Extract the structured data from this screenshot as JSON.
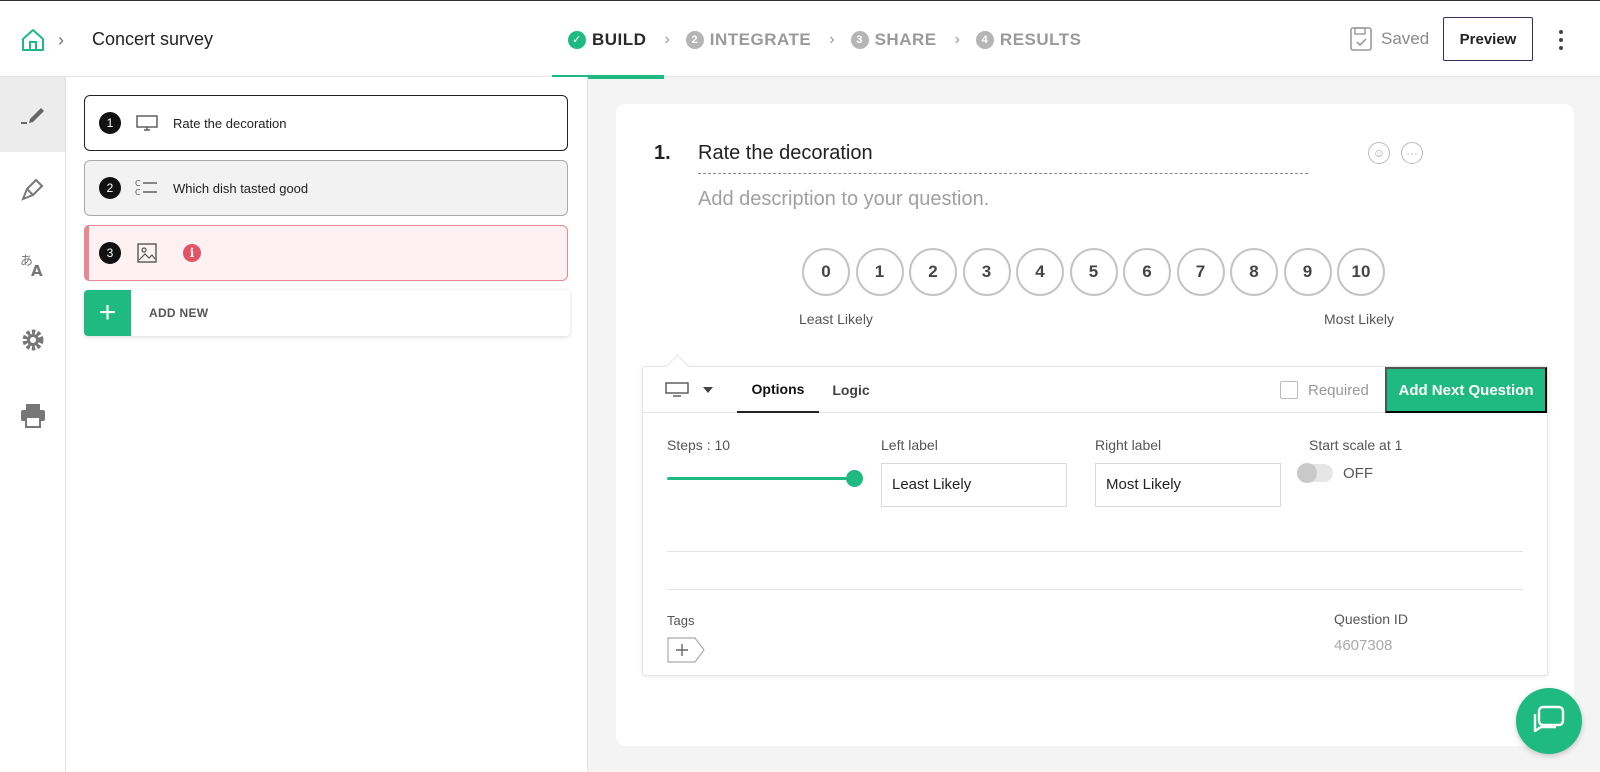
{
  "header": {
    "survey_title": "Concert survey",
    "steps": [
      {
        "num": "✓",
        "label": "BUILD"
      },
      {
        "num": "2",
        "label": "INTEGRATE"
      },
      {
        "num": "3",
        "label": "SHARE"
      },
      {
        "num": "4",
        "label": "RESULTS"
      }
    ],
    "saved_label": "Saved",
    "preview_label": "Preview"
  },
  "sidebar": {
    "items": [
      {
        "icon": "pen-icon",
        "active": true
      },
      {
        "icon": "paint-brush-icon",
        "active": false
      },
      {
        "icon": "translate-icon",
        "active": false
      },
      {
        "icon": "gear-icon",
        "active": false
      },
      {
        "icon": "printer-icon",
        "active": false
      }
    ]
  },
  "questions": [
    {
      "num": "1",
      "icon": "monitor-icon",
      "text": "Rate the decoration"
    },
    {
      "num": "2",
      "icon": "multiple-choice-icon",
      "text": "Which dish tasted good"
    },
    {
      "num": "3",
      "icon": "image-icon",
      "text": "",
      "error": true
    }
  ],
  "add_new_label": "ADD NEW",
  "editor": {
    "index": "1.",
    "title": "Rate the decoration",
    "description_placeholder": "Add description to your question.",
    "scale": [
      "0",
      "1",
      "2",
      "3",
      "4",
      "5",
      "6",
      "7",
      "8",
      "9",
      "10"
    ],
    "left_label": "Least Likely",
    "right_label": "Most Likely"
  },
  "options": {
    "tabs": [
      "Options",
      "Logic"
    ],
    "required_label": "Required",
    "next_button": "Add Next Question",
    "steps_label": "Steps : 10",
    "steps_value": 10,
    "left_label_title": "Left label",
    "left_label_value": "Least Likely",
    "right_label_title": "Right label",
    "right_label_value": "Most Likely",
    "start_scale_label": "Start scale at 1",
    "start_scale_state": "OFF",
    "tags_label": "Tags",
    "question_id_label": "Question ID",
    "question_id_value": "4607308"
  },
  "colors": {
    "accent": "#1fb982",
    "error": "#e35466"
  }
}
